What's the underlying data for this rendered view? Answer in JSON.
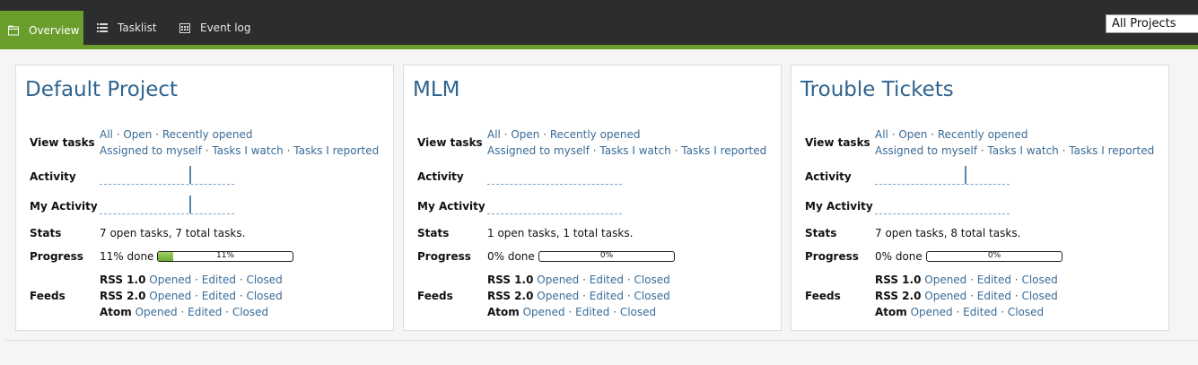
{
  "nav": {
    "tabs": [
      {
        "label": "Overview",
        "icon": "folder-icon",
        "active": true
      },
      {
        "label": "Tasklist",
        "icon": "list-icon",
        "active": false
      },
      {
        "label": "Event log",
        "icon": "calendar-icon",
        "active": false
      }
    ],
    "project_select": "All Projects"
  },
  "labels": {
    "view_tasks": "View tasks",
    "activity": "Activity",
    "my_activity": "My Activity",
    "stats": "Stats",
    "progress": "Progress",
    "feeds": "Feeds"
  },
  "links": {
    "all": "All",
    "open": "Open",
    "recently_opened": "Recently opened",
    "assigned": "Assigned to myself",
    "watch": "Tasks I watch",
    "reported": "Tasks I reported",
    "opened": "Opened",
    "edited": "Edited",
    "closed": "Closed"
  },
  "feeds": {
    "rss1": "RSS 1.0",
    "rss2": "RSS 2.0",
    "atom": "Atom"
  },
  "projects": [
    {
      "name": "Default Project",
      "stats": "7 open tasks, 7 total tasks.",
      "progress_text": "11% done",
      "progress_pct": 11,
      "progress_bar_label": "11%",
      "activity_peak": 1.0,
      "my_activity_peak": 1.0
    },
    {
      "name": "MLM",
      "stats": "1 open tasks, 1 total tasks.",
      "progress_text": "0% done",
      "progress_pct": 0,
      "progress_bar_label": "0%",
      "activity_peak": 0,
      "my_activity_peak": 0
    },
    {
      "name": "Trouble Tickets",
      "stats": "7 open tasks, 8 total tasks.",
      "progress_text": "0% done",
      "progress_pct": 0,
      "progress_bar_label": "0%",
      "activity_peak": 1.0,
      "my_activity_peak": 0
    }
  ],
  "colors": {
    "accent": "#6a9e2c",
    "link": "#3a6b96",
    "title": "#2f6490",
    "topbar": "#2b2d2f"
  }
}
